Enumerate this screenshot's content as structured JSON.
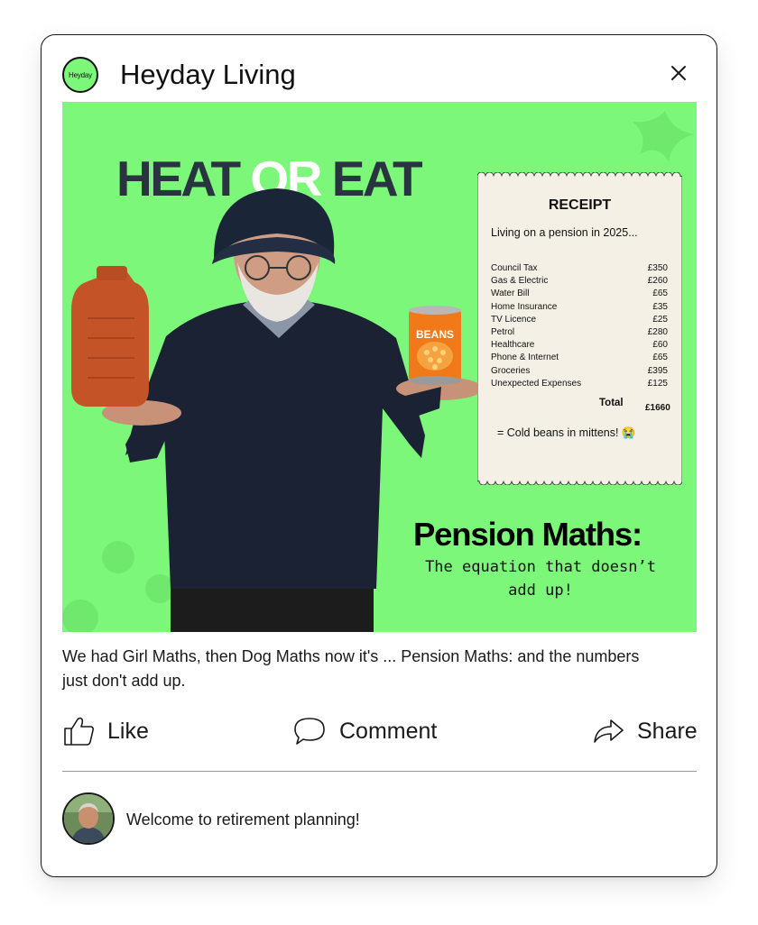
{
  "header": {
    "logo_text": "Heyday",
    "brand_name": "Heyday Living",
    "close_icon": "close-icon"
  },
  "post_image": {
    "headline": {
      "word1": "HEAT ",
      "word2": "OR",
      "word3": " EAT"
    },
    "can_label": "BEANS",
    "receipt": {
      "title": "RECEIPT",
      "subtitle": "Living on a pension in 2025...",
      "items": [
        {
          "label": "Council Tax",
          "amount": "£350"
        },
        {
          "label": "Gas & Electric",
          "amount": "£260"
        },
        {
          "label": "Water Bill",
          "amount": "£65"
        },
        {
          "label": "Home Insurance",
          "amount": "£35"
        },
        {
          "label": "TV Licence",
          "amount": "£25"
        },
        {
          "label": "Petrol",
          "amount": "£280"
        },
        {
          "label": "Healthcare",
          "amount": "£60"
        },
        {
          "label": "Phone & Internet",
          "amount": "£65"
        },
        {
          "label": "Groceries",
          "amount": "£395"
        },
        {
          "label": "Unexpected Expenses",
          "amount": "£125"
        }
      ],
      "total_label": "Total",
      "total_value": "£1660",
      "note": "= Cold beans in mittens! 😭"
    },
    "pension_title": "Pension Maths:",
    "pension_subtitle": "The equation that doesn’t add up!",
    "colors": {
      "background": "#7cf77a",
      "headline": "#2a3340"
    }
  },
  "caption": "We had Girl Maths, then Dog Maths now it's ... Pension Maths: and the numbers just don't add up.",
  "actions": {
    "like": {
      "label": "Like",
      "icon": "thumbs-up-icon"
    },
    "comment": {
      "label": "Comment",
      "icon": "speech-bubble-icon"
    },
    "share": {
      "label": "Share",
      "icon": "share-arrow-icon"
    }
  },
  "comment": {
    "text": "Welcome to retirement planning!",
    "avatar_icon": "avatar"
  }
}
